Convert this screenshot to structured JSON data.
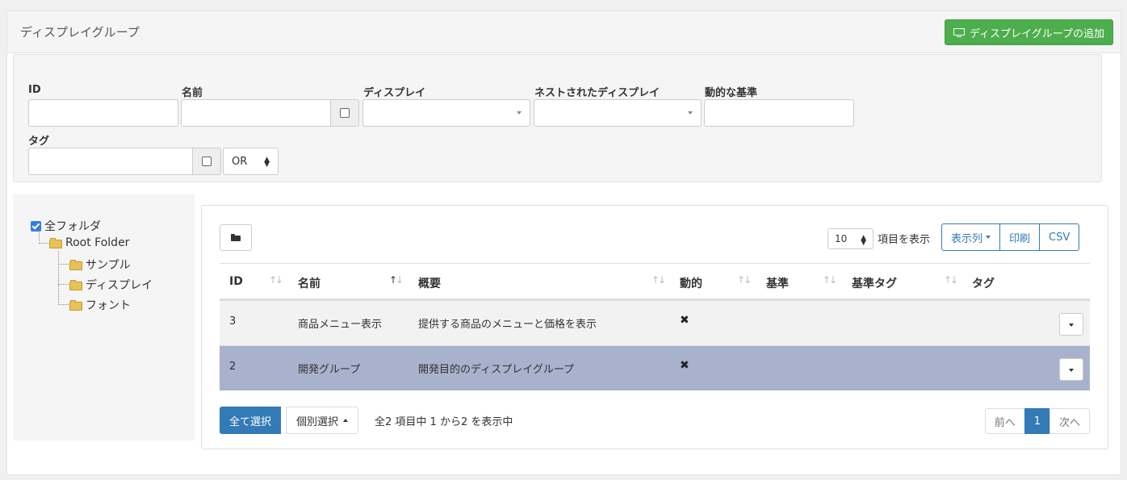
{
  "header": {
    "title": "ディスプレイグループ",
    "add_button": "ディスプレイグループの追加"
  },
  "filters": {
    "id_label": "ID",
    "name_label": "名前",
    "display_label": "ディスプレイ",
    "nested_display_label": "ネストされたディスプレイ",
    "dynamic_criteria_label": "動的な基準",
    "tag_label": "タグ",
    "tag_operator": "OR"
  },
  "tree": {
    "all_folders": "全フォルダ",
    "root": "Root Folder",
    "children": [
      "サンプル",
      "ディスプレイ",
      "フォント"
    ]
  },
  "table": {
    "page_length": "10",
    "page_length_label": "項目を表示",
    "buttons": {
      "columns": "表示列",
      "print": "印刷",
      "csv": "CSV"
    },
    "columns": [
      "ID",
      "名前",
      "概要",
      "動的",
      "基準",
      "基準タグ",
      "タグ"
    ],
    "rows": [
      {
        "id": "3",
        "name": "商品メニュー表示",
        "description": "提供する商品のメニューと価格を表示",
        "dynamic": "✖"
      },
      {
        "id": "2",
        "name": "開発グループ",
        "description": "開発目的のディスプレイグループ",
        "dynamic": "✖"
      }
    ],
    "select_all": "全て選択",
    "select_individual": "個別選択",
    "info": "全2 項目中 1 から2 を表示中",
    "pagination": {
      "prev": "前へ",
      "current": "1",
      "next": "次へ"
    }
  }
}
